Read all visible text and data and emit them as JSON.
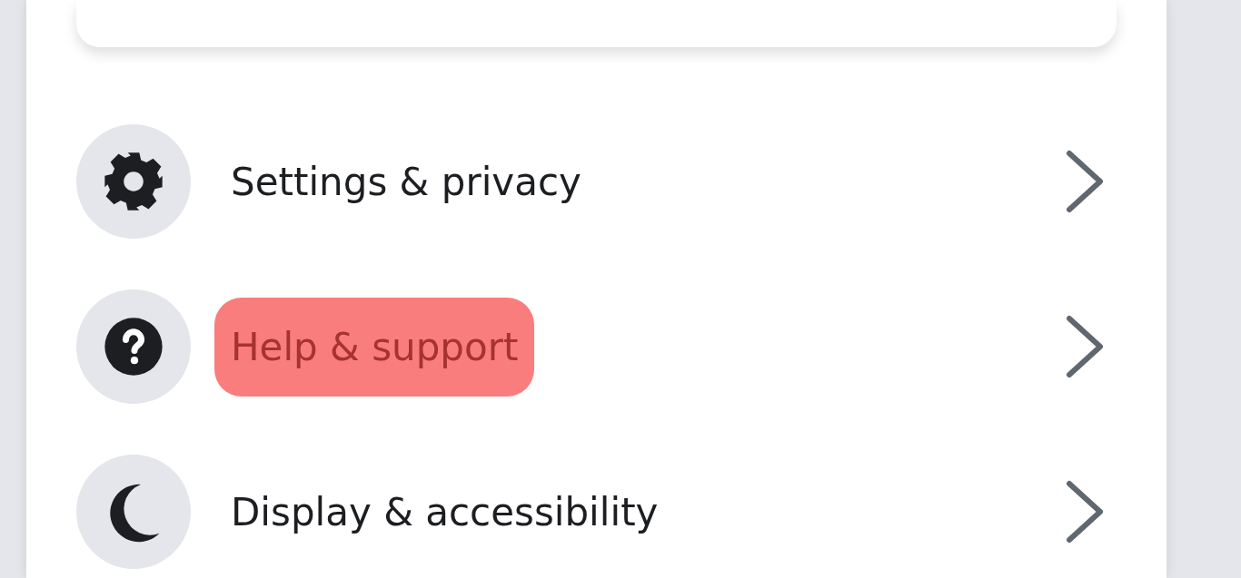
{
  "menu": {
    "items": [
      {
        "kind": "settings",
        "label": "Settings & privacy",
        "highlighted": false
      },
      {
        "kind": "help",
        "label": "Help & support",
        "highlighted": true
      },
      {
        "kind": "display",
        "label": "Display & accessibility",
        "highlighted": false
      }
    ]
  }
}
